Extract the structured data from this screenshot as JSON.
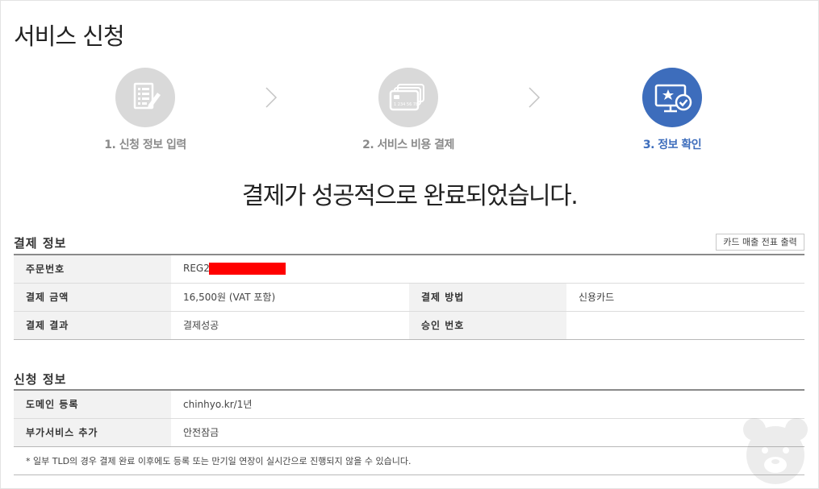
{
  "page": {
    "title": "서비스 신청"
  },
  "steps": [
    {
      "label": "1. 신청 정보 입력",
      "state": "done",
      "icon": "form-edit-icon"
    },
    {
      "label": "2. 서비스 비용 결제",
      "state": "done",
      "icon": "credit-card-icon"
    },
    {
      "label": "3. 정보 확인",
      "state": "active",
      "icon": "monitor-check-icon"
    }
  ],
  "card_number_text": "1 234 56 78",
  "message": "결제가 성공적으로 완료되었습니다.",
  "payment": {
    "section_title": "결제 정보",
    "receipt_button": "카드 매출 전표 출력",
    "order_label": "주문번호",
    "order_value": "REG2",
    "amount_label": "결제 금액",
    "amount_value": "16,500원 (VAT 포함)",
    "method_label": "결제 방법",
    "method_value": "신용카드",
    "result_label": "결제 결과",
    "result_value": "결제성공",
    "approval_label": "승인 번호",
    "approval_value": ""
  },
  "application": {
    "section_title": "신청 정보",
    "domain_label": "도메인 등록",
    "domain_value": "chinhyo.kr/1년",
    "addon_label": "부가서비스 추가",
    "addon_value": "안전잠금",
    "note": "* 일부 TLD의 경우 결제 완료 이후에도 등록 또는 만기일 연장이 실시간으로 진행되지 않을 수 있습니다."
  },
  "colors": {
    "accent": "#3d6dbc",
    "inactive": "#d9d9d9",
    "redaction": "#ff0000"
  }
}
